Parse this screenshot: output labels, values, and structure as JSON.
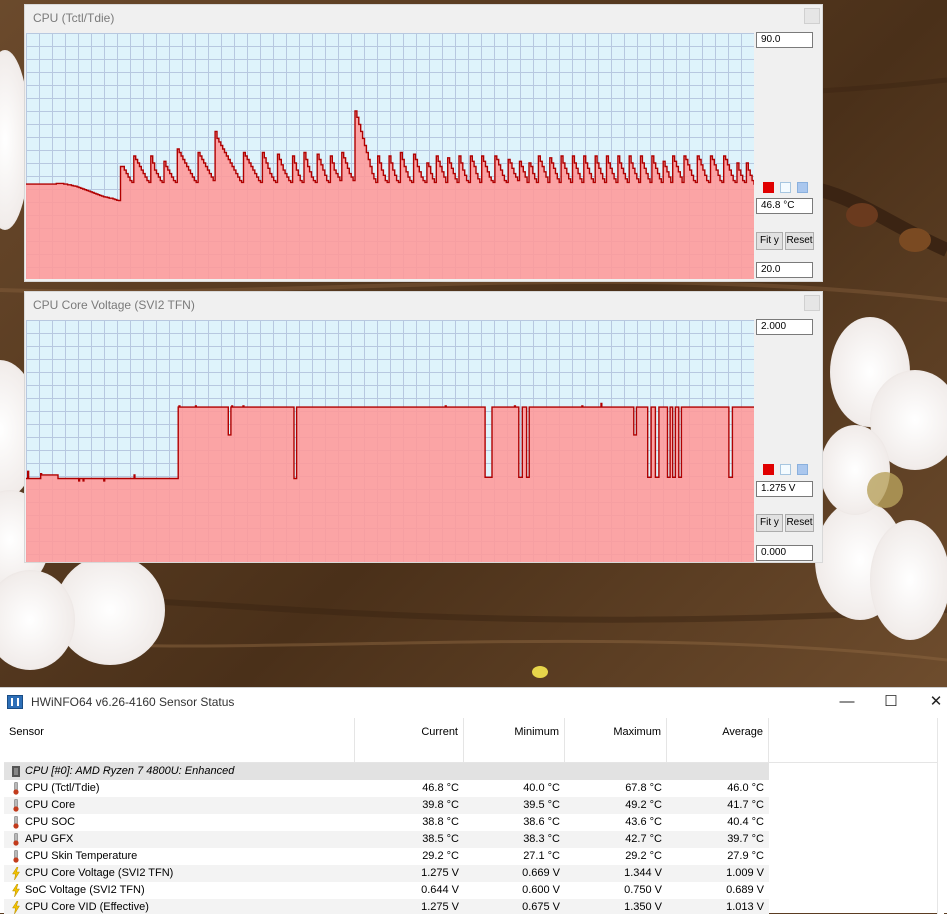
{
  "graphs": [
    {
      "title": "CPU (Tctl/Tdie)",
      "max_label": "90.0",
      "current_label": "46.8 °C",
      "min_label": "20.0",
      "fit_label": "Fit y",
      "reset_label": "Reset",
      "y_range": [
        20,
        90
      ],
      "line_color": "#b00000",
      "fill_color": "#ff9999",
      "values": [
        47,
        47,
        47,
        47,
        47,
        47,
        47,
        47,
        47,
        47,
        47,
        47,
        47,
        47,
        47,
        47,
        47.2,
        47.2,
        47.2,
        47.2,
        47,
        47,
        46.8,
        46.8,
        46.6,
        46.5,
        46.4,
        46.2,
        46,
        45.8,
        45.6,
        45.4,
        45.2,
        45,
        44.8,
        44.6,
        44.4,
        44.2,
        44,
        43.8,
        43.6,
        43.4,
        43.3,
        43.2,
        43,
        43,
        42.8,
        42.6,
        42.4,
        42.3,
        52,
        52,
        51,
        50,
        49,
        48,
        47.5,
        55,
        54,
        53,
        52,
        51,
        50,
        49,
        48,
        47.5,
        55,
        53,
        51,
        50,
        49,
        48,
        47.5,
        53.5,
        52,
        51,
        50,
        49,
        48,
        47.5,
        57,
        56,
        55,
        54,
        53,
        52,
        51,
        50,
        49,
        48,
        47.5,
        56,
        55,
        54,
        53,
        52,
        51,
        50,
        49,
        48,
        62,
        60,
        59,
        58,
        57,
        56,
        55,
        54,
        53,
        52,
        51,
        50,
        49,
        48,
        47.5,
        56,
        55,
        54,
        53,
        52,
        51,
        50,
        49,
        48,
        47.5,
        56,
        54.5,
        53,
        51.5,
        50,
        49,
        48,
        47.5,
        55.5,
        54,
        52.5,
        51,
        50,
        49,
        48,
        47.5,
        55,
        53,
        51,
        49.5,
        48,
        47.5,
        56,
        54,
        52,
        50.5,
        49,
        48,
        47.5,
        55.5,
        54,
        52.5,
        51,
        49.5,
        48,
        47.5,
        55,
        53,
        51,
        50,
        49,
        48,
        56,
        54.5,
        53,
        51.5,
        50,
        49,
        48,
        67.8,
        66,
        64,
        62,
        60,
        58,
        56,
        54,
        52,
        50,
        48.5,
        47.5,
        55,
        53,
        51,
        49.5,
        48,
        47.5,
        55,
        53,
        51,
        49.5,
        48,
        47.5,
        56,
        54,
        52,
        50.5,
        49,
        48,
        47.5,
        55.5,
        54,
        52,
        50.5,
        49,
        48,
        47.5,
        53,
        52,
        50,
        48.5,
        47.5,
        55,
        53.5,
        52,
        50.5,
        49,
        47.5,
        54.5,
        53,
        51.5,
        50,
        48.5,
        47.5,
        55,
        53,
        51,
        49.5,
        48,
        47.5,
        55,
        53.5,
        52,
        50,
        48.5,
        47.5,
        55,
        53.5,
        52,
        50.5,
        49,
        48,
        47.5,
        55,
        54,
        52.5,
        51,
        49.5,
        48,
        47.5,
        54,
        53,
        51.5,
        50,
        49,
        48,
        53.5,
        52,
        50.5,
        49,
        47.5,
        53,
        52,
        50,
        48.5,
        47.5,
        55,
        53.5,
        52,
        50.5,
        49,
        47.5,
        54.5,
        53,
        51.5,
        50,
        48.5,
        47.5,
        55,
        53,
        51.5,
        50,
        48.5,
        47.5,
        55,
        53,
        51.5,
        50,
        48.5,
        47.5,
        55,
        53,
        51.5,
        50,
        48.5,
        47.5,
        55,
        53,
        51.5,
        50,
        48.5,
        47.5,
        55,
        53,
        51.5,
        50,
        48.5,
        47.5,
        55,
        53,
        51.5,
        50,
        48.5,
        47.5,
        55,
        53,
        51.5,
        50,
        48.5,
        47.5,
        55,
        53,
        51.5,
        50,
        48.5,
        47.5,
        55,
        53,
        51.5,
        50,
        48.5,
        47.5,
        53.5,
        52,
        50.5,
        49,
        47.5,
        55,
        53.5,
        52,
        50.5,
        49,
        47.5,
        55,
        54,
        52.5,
        51,
        49.5,
        48,
        47.5,
        55,
        54,
        52.5,
        51,
        49.5,
        48,
        47.5,
        55,
        54,
        52.5,
        51,
        49.5,
        48,
        47.5,
        55,
        54,
        52.5,
        51,
        49.5,
        48,
        47.5,
        53,
        51,
        49.5,
        48,
        47.5,
        53,
        51,
        49.5,
        48,
        46.8
      ]
    },
    {
      "title": "CPU Core Voltage (SVI2 TFN)",
      "max_label": "2.000",
      "current_label": "1.275 V",
      "min_label": "0.000",
      "fit_label": "Fit y",
      "reset_label": "Reset",
      "y_range": [
        0,
        2
      ],
      "line_color": "#b00000",
      "fill_color": "#ff9999",
      "values": [
        0.69,
        0.69,
        0.75,
        0.69,
        0.69,
        0.69,
        0.69,
        0.69,
        0.69,
        0.69,
        0.69,
        0.69,
        0.69,
        0.69,
        0.69,
        0.69,
        0.69,
        0.73,
        0.72,
        0.72,
        0.72,
        0.72,
        0.72,
        0.72,
        0.72,
        0.72,
        0.72,
        0.72,
        0.72,
        0.72,
        0.72,
        0.72,
        0.72,
        0.72,
        0.72,
        0.72,
        0.72,
        0.69,
        0.69,
        0.69,
        0.69,
        0.69,
        0.69,
        0.69,
        0.69,
        0.69,
        0.69,
        0.69,
        0.69,
        0.69,
        0.69,
        0.69,
        0.69,
        0.69,
        0.69,
        0.69,
        0.69,
        0.69,
        0.69,
        0.69,
        0.69,
        0.67,
        0.69,
        0.69,
        0.69,
        0.69,
        0.67,
        0.69,
        0.69,
        0.69,
        0.69,
        0.69,
        0.69,
        0.69,
        0.69,
        0.69,
        0.69,
        0.69,
        0.69,
        0.69,
        0.69,
        0.69,
        0.69,
        0.69,
        0.69,
        0.69,
        0.69,
        0.69,
        0.69,
        0.69,
        0.67,
        0.69,
        0.69,
        0.69,
        0.69,
        0.69,
        0.69,
        0.69,
        0.69,
        0.69,
        0.69,
        0.69,
        0.69,
        0.69,
        0.69,
        0.69,
        0.69,
        0.69,
        0.69,
        0.69,
        0.69,
        0.69,
        0.69,
        0.69,
        0.69,
        0.69,
        0.69,
        0.69,
        0.69,
        0.69,
        0.69,
        0.69,
        0.69,
        0.69,
        0.69,
        0.72,
        0.69,
        0.69,
        0.69,
        0.69,
        0.69,
        0.69,
        0.69,
        0.69,
        0.69,
        0.69,
        0.69,
        0.69,
        0.69,
        0.69,
        0.69,
        0.69,
        0.69,
        0.69,
        0.69,
        0.69,
        0.69,
        0.69,
        0.69,
        0.69,
        0.69,
        0.69,
        0.69,
        0.69,
        0.69,
        0.69,
        0.69,
        0.69,
        0.69,
        0.69,
        0.69,
        0.69,
        0.69,
        0.69,
        0.69,
        0.69,
        0.69,
        0.69,
        0.69,
        0.69,
        0.69,
        0.69,
        0.69,
        0.69,
        0.69,
        0.69,
        1.28,
        1.29,
        1.28,
        1.28,
        1.28,
        1.28,
        1.28,
        1.28,
        1.28,
        1.28,
        1.28,
        1.28,
        1.28,
        1.28,
        1.28,
        1.28,
        1.28,
        1.28,
        1.28,
        1.28,
        1.29,
        1.28,
        1.28,
        1.28,
        1.28,
        1.28,
        1.28,
        1.28,
        1.28,
        1.28,
        1.28,
        1.28,
        1.28,
        1.28,
        1.28,
        1.28,
        1.28,
        1.28,
        1.28,
        1.28,
        1.28,
        1.28,
        1.28,
        1.28,
        1.28,
        1.28,
        1.28,
        1.28,
        1.28,
        1.28,
        1.28,
        1.28,
        1.28,
        1.28,
        1.28,
        1.28,
        1.28,
        1.28,
        1.05,
        1.05,
        1.05,
        1.28,
        1.29,
        1.28,
        1.28,
        1.28,
        1.28,
        1.28,
        1.28,
        1.28,
        1.28,
        1.28,
        1.28,
        1.28,
        1.28,
        1.29,
        1.28,
        1.28,
        1.28,
        1.28,
        1.28,
        1.28,
        1.28,
        1.28,
        1.28,
        1.28,
        1.28,
        1.28,
        1.28,
        1.28,
        1.28,
        1.28,
        1.28,
        1.28,
        1.28,
        1.28,
        1.28,
        1.28,
        1.28,
        1.28,
        1.28,
        1.28,
        1.28,
        1.28,
        1.28,
        1.28,
        1.28,
        1.28,
        1.28,
        1.28,
        1.28,
        1.28,
        1.28,
        1.28,
        1.28,
        1.28,
        1.28,
        1.28,
        1.28,
        1.28,
        1.28,
        1.28,
        1.28,
        1.28,
        1.28,
        1.28,
        1.28,
        1.28,
        1.28,
        1.28,
        1.28,
        1.28,
        1.28,
        1.28,
        0.69,
        0.69,
        0.69,
        1.28,
        1.28,
        1.28,
        1.28,
        1.28,
        1.28,
        1.28,
        1.28,
        1.28,
        1.28,
        1.28,
        1.28,
        1.28,
        1.28,
        1.28,
        1.28,
        1.28,
        1.28,
        1.28,
        1.28,
        1.28,
        1.28,
        1.28,
        1.28,
        1.28,
        1.28,
        1.28,
        1.28,
        1.28,
        1.28,
        1.28,
        1.28,
        1.28,
        1.28,
        1.28,
        1.28,
        1.28,
        1.28,
        1.28,
        1.28,
        1.28,
        1.28,
        1.28,
        1.28,
        1.28,
        1.28,
        1.28,
        1.28,
        1.28,
        1.28,
        1.28,
        1.28,
        1.28,
        1.28,
        1.28,
        1.28,
        1.28,
        1.28,
        1.28,
        1.28,
        1.28,
        1.28,
        1.28,
        1.28,
        1.28,
        1.28,
        1.28,
        1.28,
        1.28,
        1.28,
        1.28,
        1.28,
        1.28,
        1.28,
        1.28,
        1.28,
        1.28,
        1.28,
        1.28,
        1.28,
        1.28,
        1.28,
        1.28,
        1.28,
        1.28,
        1.28,
        1.28,
        1.28,
        1.28,
        1.28,
        1.28,
        1.28,
        1.28,
        1.28,
        1.28,
        1.28,
        1.28,
        1.28,
        1.28,
        1.28,
        1.28,
        1.28,
        1.28,
        1.28,
        1.28,
        1.28,
        1.28,
        1.28,
        1.28,
        1.28,
        1.28,
        1.28,
        1.28,
        1.28,
        1.28,
        1.28,
        1.28,
        1.28,
        1.28,
        1.28,
        1.28,
        1.28,
        1.28,
        1.28,
        1.28,
        1.28,
        1.28,
        1.28,
        1.28,
        1.28,
        1.28,
        1.28,
        1.28,
        1.28,
        1.28,
        1.28,
        1.28,
        1.28,
        1.28,
        1.28,
        1.28,
        1.28,
        1.28,
        1.28,
        1.28,
        1.28,
        1.28,
        1.28,
        1.28,
        1.28,
        1.28,
        1.28,
        1.28,
        1.28,
        1.28,
        1.28,
        1.28,
        1.28,
        1.28,
        1.28,
        1.28,
        1.28,
        1.28,
        1.28,
        1.28,
        1.28,
        1.28,
        1.28,
        1.28,
        1.28,
        1.28,
        1.28,
        1.29,
        1.28,
        1.28,
        1.28,
        1.28,
        1.28,
        1.28,
        1.28,
        1.28,
        1.28,
        1.28,
        1.28,
        1.28,
        1.28,
        1.28,
        1.28,
        1.28,
        1.28,
        1.28,
        1.28,
        1.28,
        1.28,
        1.28,
        1.28,
        1.28,
        1.28,
        1.28,
        1.28,
        1.28,
        1.28,
        1.28,
        1.28,
        1.28,
        1.28,
        1.28,
        1.28,
        1.28,
        1.28,
        1.28,
        1.28,
        1.28,
        1.28,
        1.28,
        1.28,
        1.28,
        1.28,
        0.7,
        0.7,
        0.7,
        0.7,
        0.7,
        0.7,
        0.7,
        0.7,
        1.28,
        1.28,
        1.28,
        1.28,
        1.28,
        1.28,
        1.28,
        1.28,
        1.28,
        1.28,
        1.28,
        1.28,
        1.28,
        1.28,
        1.28,
        1.28,
        1.28,
        1.28,
        1.28,
        1.28,
        1.28,
        1.28,
        1.28,
        1.28,
        1.28,
        1.28,
        1.29,
        1.28,
        1.28,
        1.28,
        1.28,
        0.7,
        0.7,
        0.7,
        0.7,
        1.28,
        1.28,
        1.28,
        1.28,
        1.28,
        0.7,
        0.7,
        0.7,
        1.28,
        1.28,
        1.28,
        1.28,
        1.28,
        1.28,
        1.28,
        1.28,
        1.28,
        1.28,
        1.28,
        1.28,
        1.28,
        1.28,
        1.28,
        1.28,
        1.28,
        1.28,
        1.28,
        1.28,
        1.28,
        1.28,
        1.28,
        1.28,
        1.28,
        1.28,
        1.28,
        1.28,
        1.28,
        1.28,
        1.28,
        1.28,
        1.28,
        1.28,
        1.28,
        1.28,
        1.28,
        1.28,
        1.28,
        1.28,
        1.28,
        1.28,
        1.28,
        1.28,
        1.28,
        1.28,
        1.28,
        1.28,
        1.28,
        1.28,
        1.28,
        1.28,
        1.28,
        1.28,
        1.28,
        1.28,
        1.28,
        1.28,
        1.28,
        1.28,
        1.28,
        1.29,
        1.28,
        1.28,
        1.28,
        1.28,
        1.28,
        1.28,
        1.28,
        1.28,
        1.28,
        1.28,
        1.28,
        1.28,
        1.28,
        1.28,
        1.28,
        1.28,
        1.28,
        1.28,
        1.28,
        1.28,
        1.28,
        1.31,
        1.28,
        1.28,
        1.28,
        1.28,
        1.28,
        1.28,
        1.28,
        1.28,
        1.28,
        1.28,
        1.28,
        1.28,
        1.28,
        1.28,
        1.28,
        1.28,
        1.28,
        1.28,
        1.28,
        1.28,
        1.28,
        1.28,
        1.28,
        1.28,
        1.28,
        1.28,
        1.28,
        1.28,
        1.28,
        1.28,
        1.28,
        1.28,
        1.28,
        1.28,
        1.28,
        1.28,
        1.28,
        1.05,
        1.05,
        1.05,
        1.28,
        1.28,
        1.28,
        1.28,
        1.28,
        1.28,
        1.28,
        1.28,
        1.28,
        1.28,
        1.28,
        1.28,
        1.28,
        0.7,
        0.7,
        0.7,
        0.7,
        1.28,
        1.28,
        1.28,
        1.28,
        1.28,
        0.7,
        0.7,
        0.7,
        0.7,
        1.28,
        1.28,
        1.28,
        1.28,
        1.28,
        1.28,
        1.28,
        1.28,
        1.28,
        1.28,
        0.7,
        0.7,
        0.7,
        1.28,
        1.28,
        1.28,
        0.7,
        0.7,
        0.7,
        1.28,
        1.28,
        1.28,
        1.28,
        0.7,
        0.7,
        0.7,
        1.28,
        1.28,
        1.28,
        1.28,
        1.28,
        1.28,
        1.28,
        1.28,
        1.28,
        1.28,
        1.28,
        1.28,
        1.28,
        1.28,
        1.28,
        1.28,
        1.28,
        1.28,
        1.28,
        1.28,
        1.28,
        1.28,
        1.28,
        1.28,
        1.28,
        1.28,
        1.28,
        1.28,
        1.28,
        1.28,
        1.28,
        1.28,
        1.28,
        1.28,
        1.28,
        1.28,
        1.28,
        1.28,
        1.28,
        1.28,
        1.28,
        1.28,
        1.28,
        1.28,
        1.28,
        1.28,
        1.28,
        1.28,
        1.28,
        1.28,
        1.28,
        1.28,
        1.28,
        1.28,
        1.28,
        0.7,
        0.7,
        0.7,
        0.7,
        1.28,
        1.28,
        1.28,
        1.28,
        1.28,
        1.28,
        1.28,
        1.28,
        1.28,
        1.28,
        1.28,
        1.28,
        1.28,
        1.28,
        1.28,
        1.28,
        1.28,
        1.28,
        1.28,
        1.28,
        1.28,
        1.28,
        1.28,
        1.28,
        1.28,
        1.275
      ]
    }
  ],
  "hwinfo": {
    "title": "HWiNFO64 v6.26-4160 Sensor Status",
    "columns": [
      "Sensor",
      "Current",
      "Minimum",
      "Maximum",
      "Average"
    ],
    "group": "CPU [#0]: AMD Ryzen 7 4800U: Enhanced",
    "rows": [
      {
        "icon": "thermometer",
        "name": "CPU (Tctl/Tdie)",
        "current": "46.8 °C",
        "min": "40.0 °C",
        "max": "67.8 °C",
        "avg": "46.0 °C"
      },
      {
        "icon": "thermometer",
        "name": "CPU Core",
        "current": "39.8 °C",
        "min": "39.5 °C",
        "max": "49.2 °C",
        "avg": "41.7 °C"
      },
      {
        "icon": "thermometer",
        "name": "CPU SOC",
        "current": "38.8 °C",
        "min": "38.6 °C",
        "max": "43.6 °C",
        "avg": "40.4 °C"
      },
      {
        "icon": "thermometer",
        "name": "APU GFX",
        "current": "38.5 °C",
        "min": "38.3 °C",
        "max": "42.7 °C",
        "avg": "39.7 °C"
      },
      {
        "icon": "thermometer",
        "name": "CPU Skin Temperature",
        "current": "29.2 °C",
        "min": "27.1 °C",
        "max": "29.2 °C",
        "avg": "27.9 °C"
      },
      {
        "icon": "lightning",
        "name": "CPU Core Voltage (SVI2 TFN)",
        "current": "1.275 V",
        "min": "0.669 V",
        "max": "1.344 V",
        "avg": "1.009 V"
      },
      {
        "icon": "lightning",
        "name": "SoC Voltage (SVI2 TFN)",
        "current": "0.644 V",
        "min": "0.600 V",
        "max": "0.750 V",
        "avg": "0.689 V"
      },
      {
        "icon": "lightning",
        "name": "CPU Core VID (Effective)",
        "current": "1.275 V",
        "min": "0.675 V",
        "max": "1.350 V",
        "avg": "1.013 V"
      }
    ]
  }
}
